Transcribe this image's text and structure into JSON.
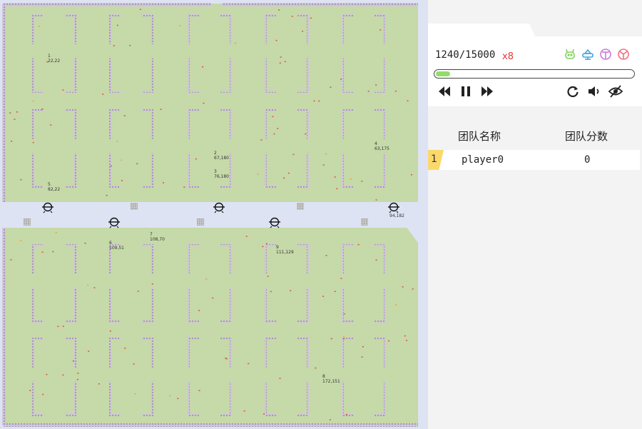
{
  "game": {
    "turn": "1240/15000",
    "speed": "x8",
    "progress_fraction": 0.07
  },
  "map": {
    "players": [
      {
        "id": "1",
        "pos": "22,22"
      },
      {
        "id": "2",
        "pos": "67,180"
      },
      {
        "id": "3",
        "pos": "76,180"
      },
      {
        "id": "4",
        "pos": "63,175"
      },
      {
        "id": "5",
        "pos": "82,22"
      },
      {
        "id": "6",
        "pos": "109,51"
      },
      {
        "id": "7",
        "pos": "108,70"
      },
      {
        "id": "8",
        "pos": "172,151"
      },
      {
        "id": "9",
        "pos": "111,129"
      },
      {
        "id": "",
        "pos": "94,182"
      }
    ]
  },
  "icons": {
    "rewind": "rewind-icon",
    "pause": "pause-icon",
    "forward": "fast-forward-icon",
    "restart": "restart-icon",
    "sound": "volume-icon",
    "view": "visibility-icon",
    "player_icons": [
      {
        "name": "robot-icon",
        "color": "#7ed35a"
      },
      {
        "name": "tank-icon",
        "color": "#3fa6e0"
      },
      {
        "name": "plane-icon",
        "color": "#c97ad6"
      },
      {
        "name": "fan-icon",
        "color": "#f07080"
      }
    ]
  },
  "scoreboard": {
    "header_name": "团队名称",
    "header_score": "团队分数",
    "rows": [
      {
        "rank": "1",
        "name": "player0",
        "score": "0"
      }
    ]
  }
}
